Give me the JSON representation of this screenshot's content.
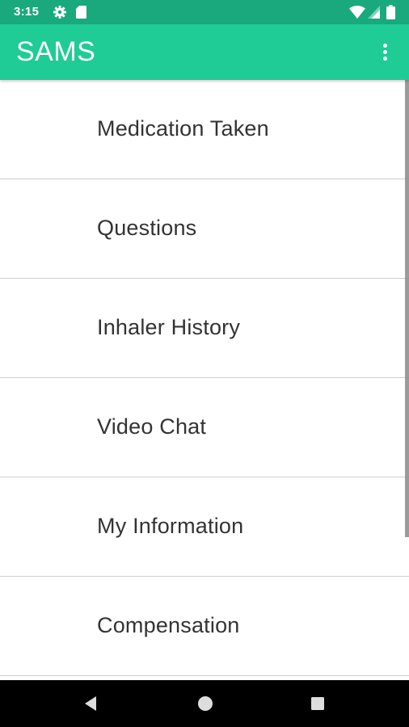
{
  "status_bar": {
    "time": "3:15",
    "icons": [
      "settings-gear-icon",
      "sd-card-icon",
      "wifi-icon",
      "signal-icon",
      "battery-icon"
    ]
  },
  "app_bar": {
    "title": "SAMS",
    "menu_icon": "more-vert-icon"
  },
  "menu": {
    "items": [
      {
        "label": "Medication Taken"
      },
      {
        "label": "Questions"
      },
      {
        "label": "Inhaler History"
      },
      {
        "label": "Video Chat"
      },
      {
        "label": "My Information"
      },
      {
        "label": "Compensation"
      }
    ]
  },
  "nav_bar": {
    "buttons": [
      "back-icon",
      "home-icon",
      "recents-icon"
    ]
  },
  "colors": {
    "status_bar": "#1aa97c",
    "app_bar": "#1fcc96",
    "text": "#333333",
    "divider": "#cfcfcf",
    "nav_bar": "#000000"
  }
}
